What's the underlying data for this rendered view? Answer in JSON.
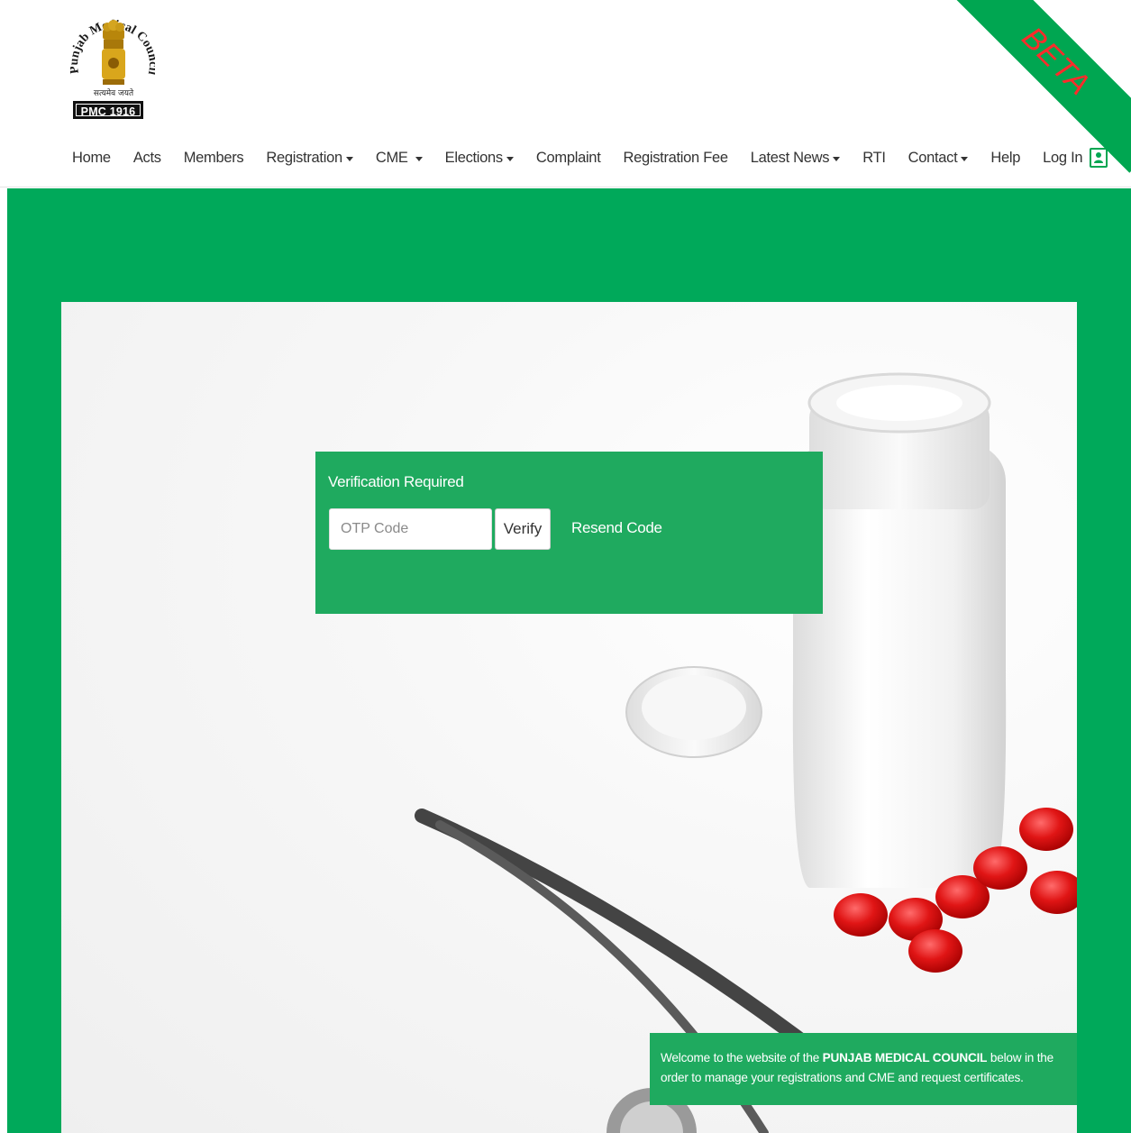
{
  "logo": {
    "arc_text": "Punjab Medical Council",
    "motto": "सत्यमेव जयते",
    "strip": "PMC 1916"
  },
  "beta": "BETA",
  "nav": {
    "items": [
      {
        "label": "Home",
        "dropdown": false
      },
      {
        "label": "Acts",
        "dropdown": false
      },
      {
        "label": "Members",
        "dropdown": false
      },
      {
        "label": "Registration",
        "dropdown": true
      },
      {
        "label": "CME",
        "dropdown": true
      },
      {
        "label": "Elections",
        "dropdown": true
      },
      {
        "label": "Complaint",
        "dropdown": false
      },
      {
        "label": "Registration Fee",
        "dropdown": false
      },
      {
        "label": "Latest News",
        "dropdown": true
      },
      {
        "label": "RTI",
        "dropdown": false
      },
      {
        "label": "Contact",
        "dropdown": true
      },
      {
        "label": "Help",
        "dropdown": false
      },
      {
        "label": "Log In",
        "dropdown": false,
        "icon": "user-login-icon"
      }
    ]
  },
  "verification": {
    "title": "Verification Required",
    "otp_placeholder": "OTP Code",
    "otp_value": "",
    "verify_label": "Verify",
    "resend_label": "Resend Code"
  },
  "welcome": {
    "prefix": "Welcome to the website of the ",
    "highlight": "PUNJAB MEDICAL COUNCIL",
    "suffix": " below in the order to manage your registrations and CME and request certificates."
  },
  "colors": {
    "brand_green": "#00a95a",
    "box_green": "#1faa5f",
    "beta_text": "#ff2b2b"
  }
}
